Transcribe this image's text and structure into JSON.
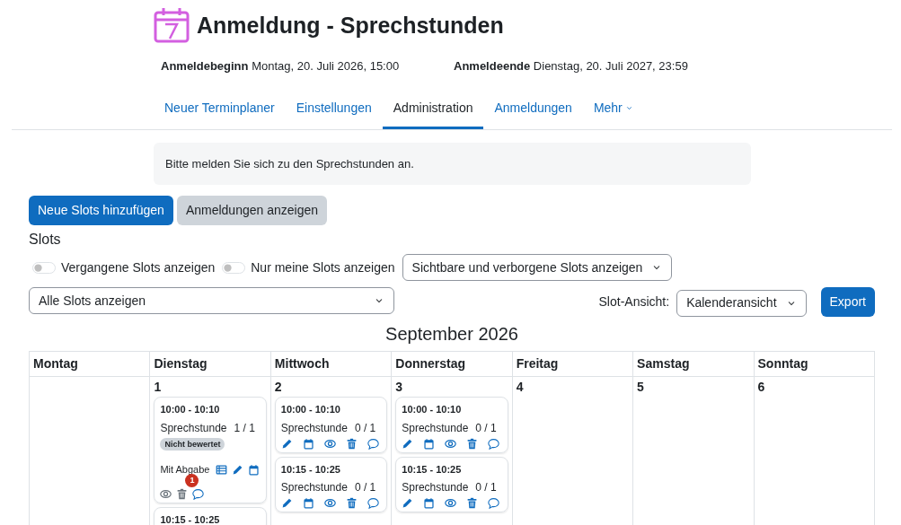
{
  "page": {
    "title": "Anmeldung - Sprechstunden"
  },
  "dates": [
    {
      "label": "Anmeldebeginn",
      "value": "Montag, 20. Juli 2026, 15:00"
    },
    {
      "label": "Anmeldeende",
      "value": "Dienstag, 20. Juli 2027, 23:59"
    }
  ],
  "tabs": [
    {
      "label": "Neuer Terminplaner",
      "selected": false,
      "kind": "link"
    },
    {
      "label": "Einstellungen",
      "selected": false,
      "kind": "link"
    },
    {
      "label": "Administration",
      "selected": true,
      "kind": "link"
    },
    {
      "label": "Anmeldungen",
      "selected": false,
      "kind": "link"
    },
    {
      "label": "Mehr",
      "selected": false,
      "kind": "dropdown"
    }
  ],
  "intro": "Bitte melden Sie sich zu den Sprechstunden an.",
  "buttons": [
    {
      "label": "Neue Slots hinzufügen",
      "kind": "primary"
    },
    {
      "label": "Anmeldungen anzeigen",
      "kind": "secondary"
    }
  ],
  "section_title": "Slots",
  "toggles": [
    {
      "label": "Vergangene Slots anzeigen",
      "on": false
    },
    {
      "label": "Nur meine Slots anzeigen",
      "on": false
    }
  ],
  "visibility_select": "Sichtbare und verborgene Slots anzeigen",
  "filter_select": "Alle Slots anzeigen",
  "view": {
    "label": "Slot-Ansicht:",
    "value": "Kalenderansicht"
  },
  "export_button": "Export",
  "calendar": {
    "month": "September 2026",
    "weekdays": [
      "Montag",
      "Dienstag",
      "Mittwoch",
      "Donnerstag",
      "Freitag",
      "Samstag",
      "Sonntag"
    ],
    "days": [
      {
        "kind": "empty"
      },
      {
        "kind": "day",
        "date": "1",
        "slots": [
          {
            "time": "10:00 - 10:10",
            "title": "Sprechstunde",
            "count": "1 / 1",
            "badge": "Nicht bewertet",
            "note": "Mit Abgabe",
            "actions": [
              {
                "kind": "grid",
                "disabled": false
              },
              {
                "kind": "edit",
                "disabled": false
              },
              {
                "kind": "calendar",
                "disabled": false
              },
              {
                "kind": "view",
                "disabled": true
              },
              {
                "kind": "delete",
                "disabled": true
              },
              {
                "kind": "comment",
                "disabled": false,
                "count": "1"
              }
            ]
          },
          {
            "time": "10:15 - 10:25"
          }
        ]
      },
      {
        "kind": "day",
        "date": "2",
        "slots": [
          {
            "time": "10:00 - 10:10",
            "title": "Sprechstunde",
            "count": "0 / 1",
            "actions": [
              {
                "kind": "edit",
                "disabled": false
              },
              {
                "kind": "calendar",
                "disabled": false
              },
              {
                "kind": "view",
                "disabled": false
              },
              {
                "kind": "delete",
                "disabled": false
              },
              {
                "kind": "comment",
                "disabled": false
              }
            ]
          },
          {
            "time": "10:15 - 10:25",
            "title": "Sprechstunde",
            "count": "0 / 1",
            "actions": [
              {
                "kind": "edit",
                "disabled": false
              },
              {
                "kind": "calendar",
                "disabled": false
              },
              {
                "kind": "view",
                "disabled": false
              },
              {
                "kind": "delete",
                "disabled": false
              },
              {
                "kind": "comment",
                "disabled": false
              }
            ]
          }
        ]
      },
      {
        "kind": "day",
        "date": "3",
        "slots": [
          {
            "time": "10:00 - 10:10",
            "title": "Sprechstunde",
            "count": "0 / 1",
            "actions": [
              {
                "kind": "edit",
                "disabled": false
              },
              {
                "kind": "calendar",
                "disabled": false
              },
              {
                "kind": "view",
                "disabled": false
              },
              {
                "kind": "delete",
                "disabled": false
              },
              {
                "kind": "comment",
                "disabled": false
              }
            ]
          },
          {
            "time": "10:15 - 10:25",
            "title": "Sprechstunde",
            "count": "0 / 1",
            "actions": [
              {
                "kind": "edit",
                "disabled": false
              },
              {
                "kind": "calendar",
                "disabled": false
              },
              {
                "kind": "view",
                "disabled": false
              },
              {
                "kind": "delete",
                "disabled": false
              },
              {
                "kind": "comment",
                "disabled": false
              }
            ]
          }
        ]
      },
      {
        "kind": "day",
        "date": "4"
      },
      {
        "kind": "day",
        "date": "5"
      },
      {
        "kind": "day",
        "date": "6"
      }
    ]
  }
}
